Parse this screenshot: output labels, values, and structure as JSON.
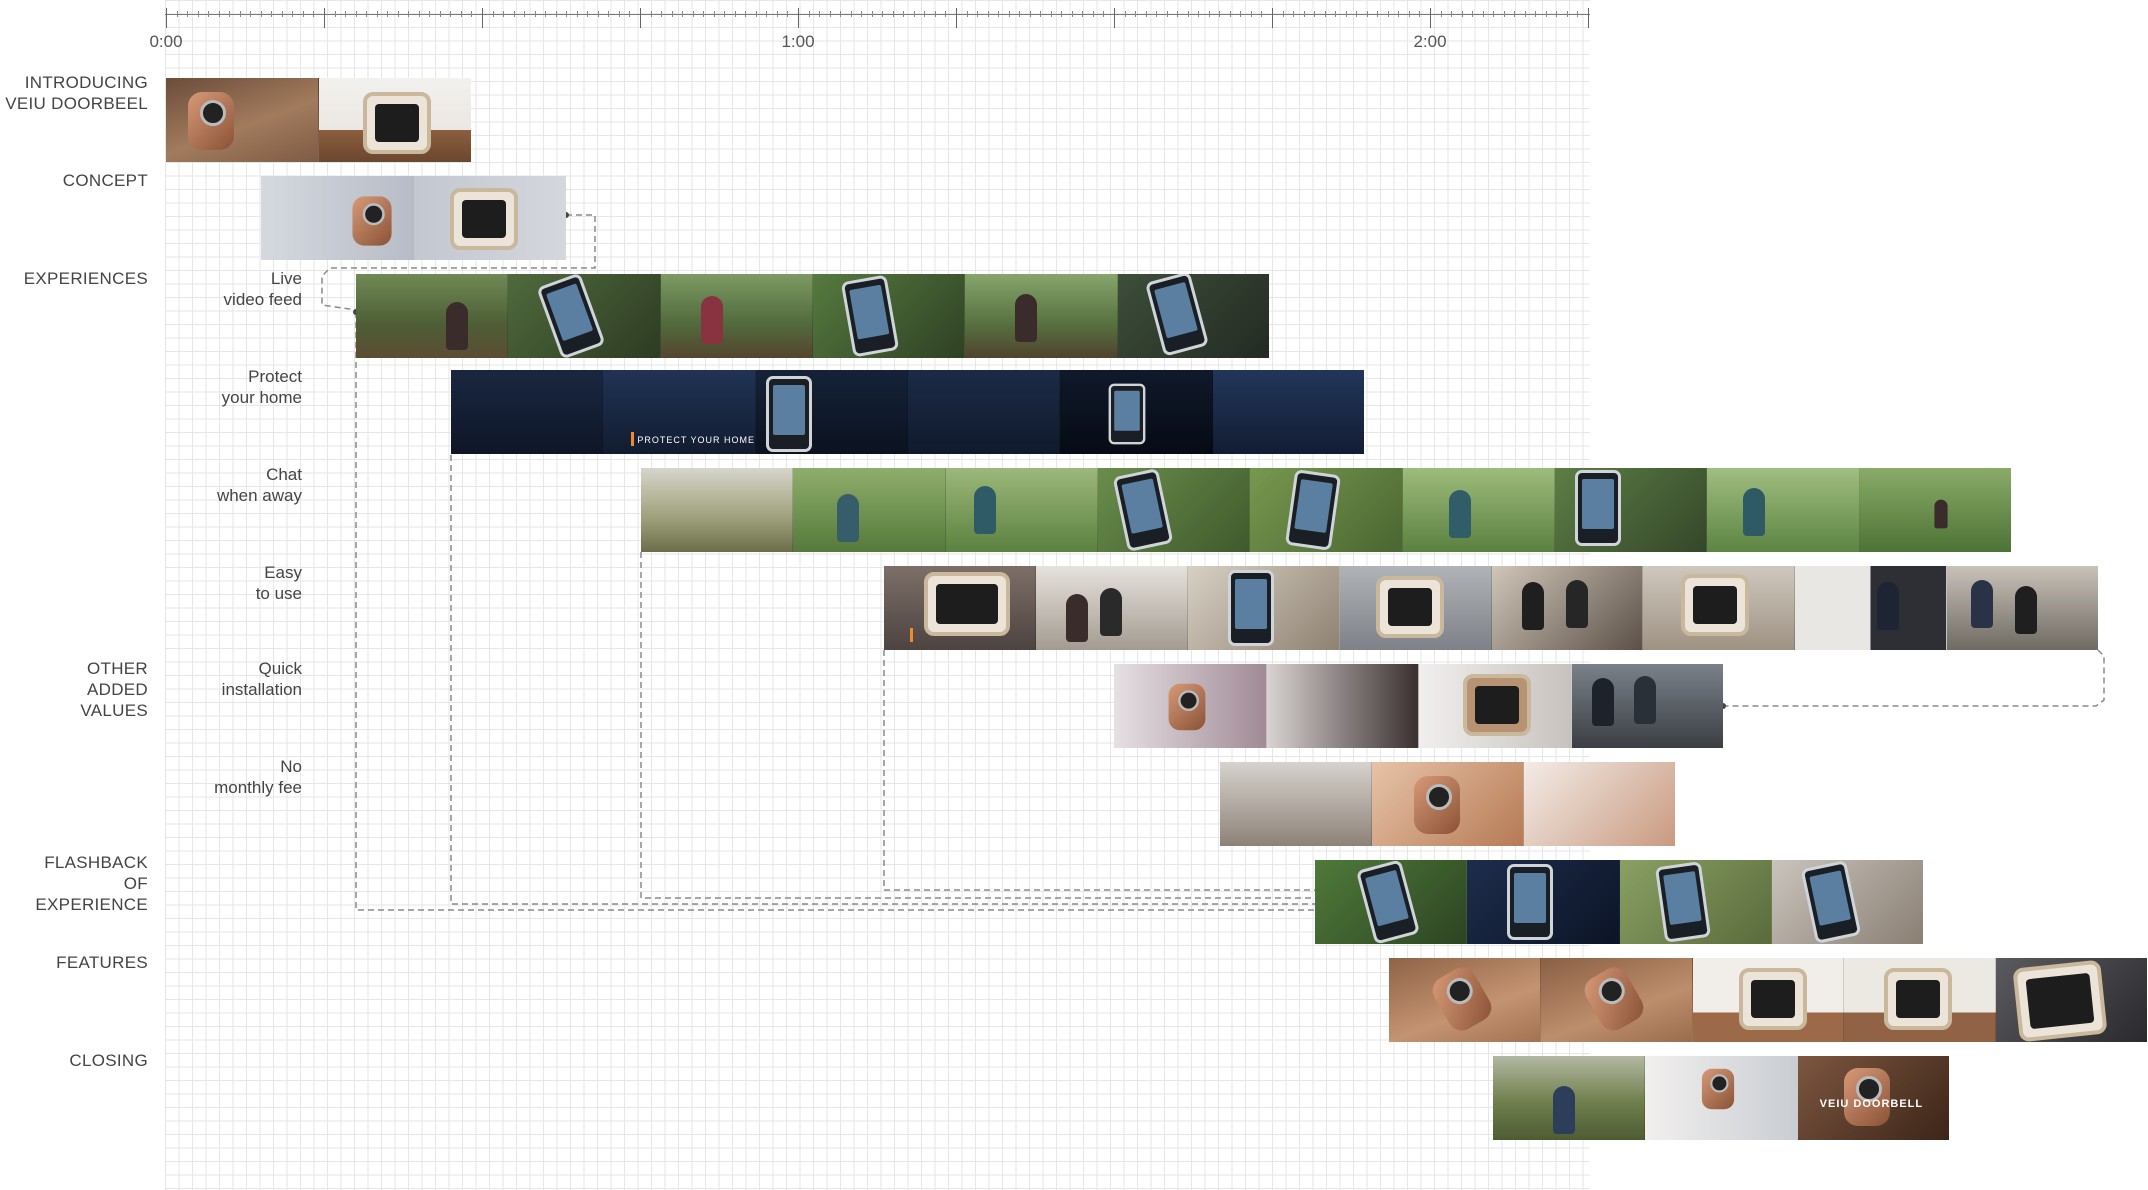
{
  "timeline": {
    "tick_labels": [
      "0:00",
      "1:00",
      "2:00"
    ]
  },
  "sections": {
    "intro": "INTRODUCING\nVEIU DOORBEEL",
    "concept": "CONCEPT",
    "experiences": "EXPERIENCES",
    "other": "OTHER\nADDED\nVALUES",
    "flashback": "FLASHBACK\nOF\nEXPERIENCE",
    "features": "FEATURES",
    "closing": "CLOSING"
  },
  "sublabels": {
    "live": "Live\nvideo feed",
    "protect": "Protect\nyour home",
    "chat": "Chat\nwhen away",
    "easy": "Easy\nto use",
    "quick": "Quick\ninstallation",
    "nofee": "No\nmonthly fee"
  },
  "overlays": {
    "protect_caption": "PROTECT YOUR HOME",
    "closing_logo": "VEIU DOORBELL"
  },
  "colors": {
    "grid": "#e6e6e6",
    "accent_orange": "#f08a2c",
    "copper": "#c07a55"
  }
}
